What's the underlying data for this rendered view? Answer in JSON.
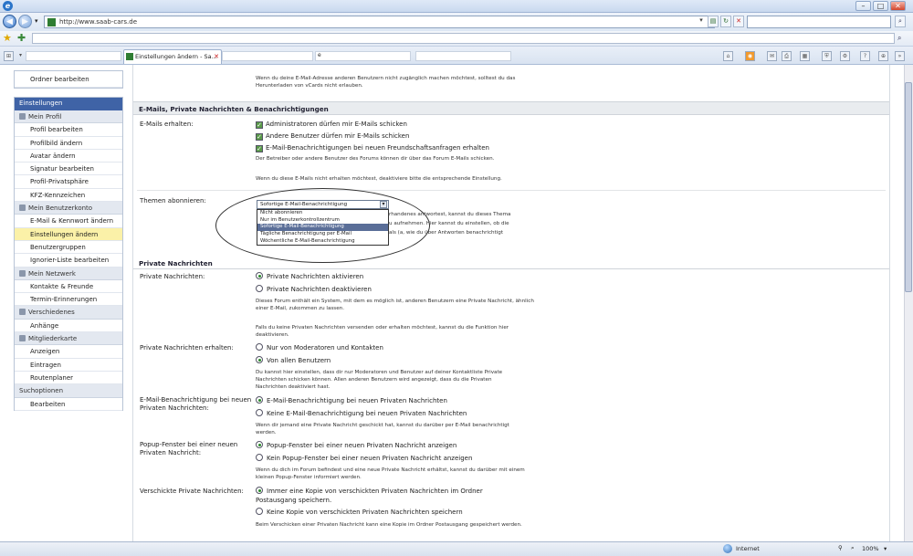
{
  "browser": {
    "url": "http://www.saab-cars.de",
    "tab_title": "Einstellungen ändern - Sa...",
    "tab_input_2": "e",
    "status_text": "Internet",
    "zoom": "100%"
  },
  "sidebar": {
    "top_item": "Ordner bearbeiten",
    "main_header": "Einstellungen",
    "groups": [
      {
        "header": "Mein Profil",
        "items": [
          "Profil bearbeiten",
          "Profilbild ändern",
          "Avatar ändern",
          "Signatur bearbeiten",
          "Profil-Privatsphäre",
          "KFZ-Kennzeichen"
        ]
      },
      {
        "header": "Mein Benutzerkonto",
        "items": [
          "E-Mail & Kennwort ändern",
          "Einstellungen ändern",
          "Benutzergruppen",
          "Ignorier-Liste bearbeiten"
        ]
      },
      {
        "header": "Mein Netzwerk",
        "items": [
          "Kontakte & Freunde",
          "Termin-Erinnerungen"
        ]
      },
      {
        "header": "Verschiedenes",
        "items": [
          "Anhänge"
        ]
      },
      {
        "header": "Mitgliederkarte",
        "items": [
          "Anzeigen",
          "Eintragen",
          "Routenplaner"
        ]
      },
      {
        "header": "Suchoptionen",
        "items": [
          "Bearbeiten"
        ]
      }
    ],
    "active_item": "Einstellungen ändern"
  },
  "main": {
    "top_note": "Wenn du deine E-Mail-Adresse anderen Benutzern nicht zugänglich machen möchtest, solltest du das Herunterladen von vCards nicht erlauben.",
    "email_section": {
      "title": "E-Mails, Private Nachrichten & Benachrichtigungen",
      "label": "E-Mails erhalten:",
      "checks": [
        "Administratoren dürfen mir E-Mails schicken",
        "Andere Benutzer dürfen mir E-Mails schicken",
        "E-Mail-Benachrichtigungen bei neuen Freundschaftsanfragen erhalten"
      ],
      "note1": "Der Betreiber oder andere Benutzer des Forums können dir über das Forum E-Mails schicken.",
      "note2": "Wenn du diese E-Mails nicht erhalten möchtest, deaktiviere bitte die entsprechende Einstellung."
    },
    "subscribe": {
      "label": "Themen abonnieren:",
      "selected": "Sofortige E-Mail-Benachrichtigung",
      "options": [
        "Nicht abonnieren",
        "Nur im Benutzerkontrollzentrum",
        "Sofortige E-Mail-Benachrichtigung",
        "Tägliche Benachrichtigung per E-Mail",
        "Wöchentliche E-Mail-Benachrichtigung"
      ],
      "partial_note_1": "rhandenes antwortest, kannst du dieses Thema",
      "partial_note_2": "u aufnehmen. Hier kannst du einstellen, ob die",
      "partial_note_3": "als (a, wie du über Antworten benachrichtigt"
    },
    "pm": {
      "title": "Private Nachrichten",
      "label1": "Private Nachrichten:",
      "opt1a": "Private Nachrichten aktivieren",
      "opt1b": "Private Nachrichten deaktivieren",
      "note1": "Dieses Forum enthält ein System, mit dem es möglich ist, anderen Benutzern eine Private Nachricht, ähnlich einer E-Mail, zukommen zu lassen.",
      "note2": "Falls du keine Privaten Nachrichten versenden oder erhalten möchtest, kannst du die Funktion hier deaktivieren.",
      "label2": "Private Nachrichten erhalten:",
      "opt2a": "Nur von Moderatoren und Kontakten",
      "opt2b": "Von allen Benutzern",
      "note3": "Du kannst hier einstellen, dass dir nur Moderatoren und Benutzer auf deiner Kontaktliste Private Nachrichten schicken können. Allen anderen Benutzern wird angezeigt, dass du die Privaten Nachrichten deaktiviert hast.",
      "label3": "E-Mail-Benachrichtigung bei neuen Privaten Nachrichten:",
      "opt3a": "E-Mail-Benachrichtigung bei neuen Privaten Nachrichten",
      "opt3b": "Keine E-Mail-Benachrichtigung bei neuen Privaten Nachrichten",
      "note4": "Wenn dir jemand eine Private Nachricht geschickt hat, kannst du darüber per E-Mail benachrichtigt werden.",
      "label4": "Popup-Fenster bei einer neuen Privaten Nachricht:",
      "opt4a": "Popup-Fenster bei einer neuen Privaten Nachricht anzeigen",
      "opt4b": "Kein Popup-Fenster bei einer neuen Privaten Nachricht anzeigen",
      "note5": "Wenn du dich im Forum befindest und eine neue Private Nachricht erhältst, kannst du darüber mit einem kleinen Popup-Fenster informiert werden.",
      "label5": "Verschickte Private Nachrichten:",
      "opt5a": "Immer eine Kopie von verschickten Privaten Nachrichten im Ordner Postausgang speichern.",
      "opt5b": "Keine Kopie von verschickten Privaten Nachrichten speichern",
      "note6": "Beim Verschicken einer Privaten Nachricht kann eine Kopie im Ordner Postausgang gespeichert werden."
    }
  }
}
